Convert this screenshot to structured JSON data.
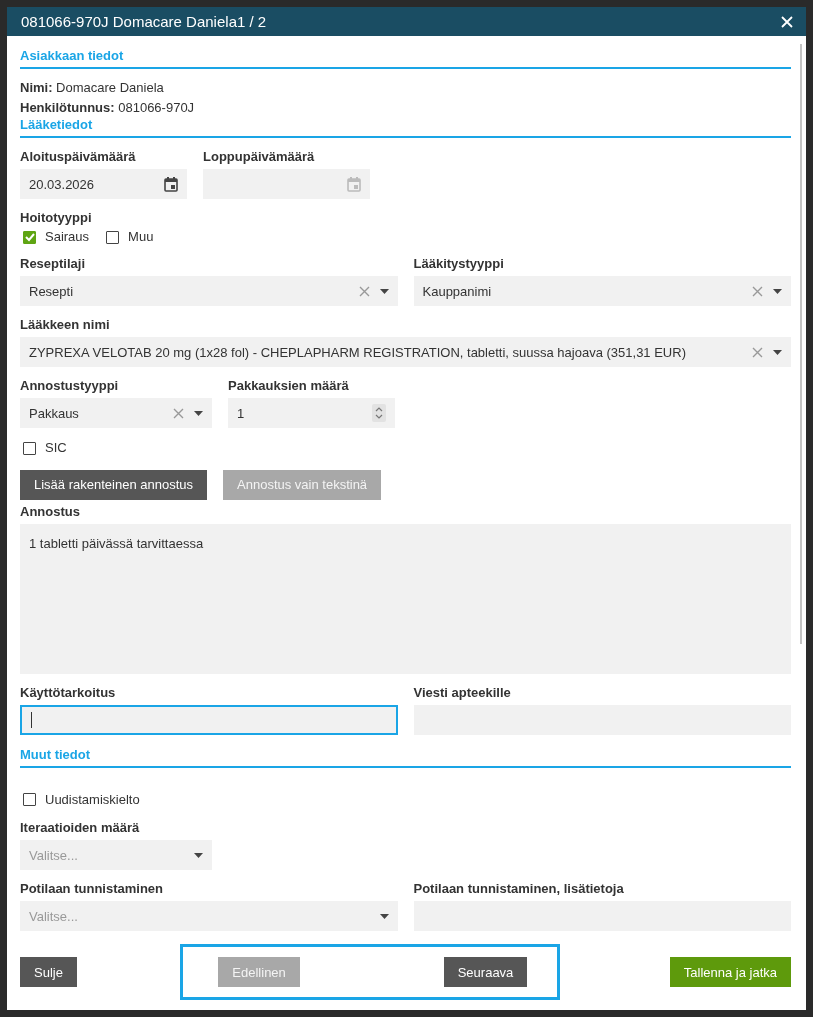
{
  "dialog_title": "081066-970J Domacare Daniela1 / 2",
  "customer": {
    "heading": "Asiakkaan tiedot",
    "fields": [
      {
        "label": "Nimi:",
        "value": "Domacare Daniela"
      },
      {
        "label": "Henkilötunnus:",
        "value": "081066-970J"
      }
    ]
  },
  "medicine": {
    "heading": "Lääketiedot",
    "start_date": {
      "label": "Aloituspäivämäärä",
      "value": "20.03.2026",
      "disabled": false
    },
    "end_date": {
      "label": "Loppupäivämäärä",
      "disabled": true
    },
    "care_type": {
      "label": "Hoitotyyppi",
      "options": [
        {
          "label": "Sairaus",
          "checked": true
        },
        {
          "label": "Muu",
          "checked": false
        }
      ]
    },
    "prescription_type": {
      "label": "Reseptilaji",
      "value": "Resepti"
    },
    "medication_type": {
      "label": "Lääkitystyyppi",
      "value": "Kauppanimi"
    },
    "medicine_name": {
      "label": "Lääkkeen nimi",
      "value": "ZYPREXA VELOTAB 20 mg (1x28 fol) - CHEPLAPHARM REGISTRATION, tabletti, suussa hajoava (351,31 EUR)"
    },
    "dosage_type": {
      "label": "Annostustyyppi",
      "value": "Pakkaus"
    },
    "package_count": {
      "label": "Pakkauksien määrä",
      "value": "1"
    },
    "sic": {
      "label": "SIC",
      "checked": false
    },
    "dosage_buttons": [
      {
        "label": "Lisää rakenteinen annostus",
        "selected": true
      },
      {
        "label": "Annostus vain tekstinä",
        "selected": false
      }
    ],
    "dosage": {
      "label": "Annostus",
      "value": "1 tabletti päivässä tarvittaessa"
    },
    "purpose": {
      "label": "Käyttötarkoitus",
      "focused": true
    },
    "pharmacy_message": {
      "label": "Viesti apteekille"
    }
  },
  "other": {
    "heading": "Muut tiedot",
    "renewal_ban": {
      "label": "Uudistamiskielto",
      "checked": false
    },
    "iterations": {
      "label": "Iteraatioiden määrä",
      "placeholder": "Valitse..."
    },
    "patient_id": {
      "label": "Potilaan tunnistaminen",
      "placeholder": "Valitse..."
    },
    "patient_id_info": {
      "label": "Potilaan tunnistaminen, lisätietoja"
    }
  },
  "footer": {
    "close": "Sulje",
    "previous": {
      "label": "Edellinen",
      "disabled": true
    },
    "next": {
      "label": "Seuraava",
      "disabled": false
    },
    "save": "Tallenna ja jatka"
  }
}
